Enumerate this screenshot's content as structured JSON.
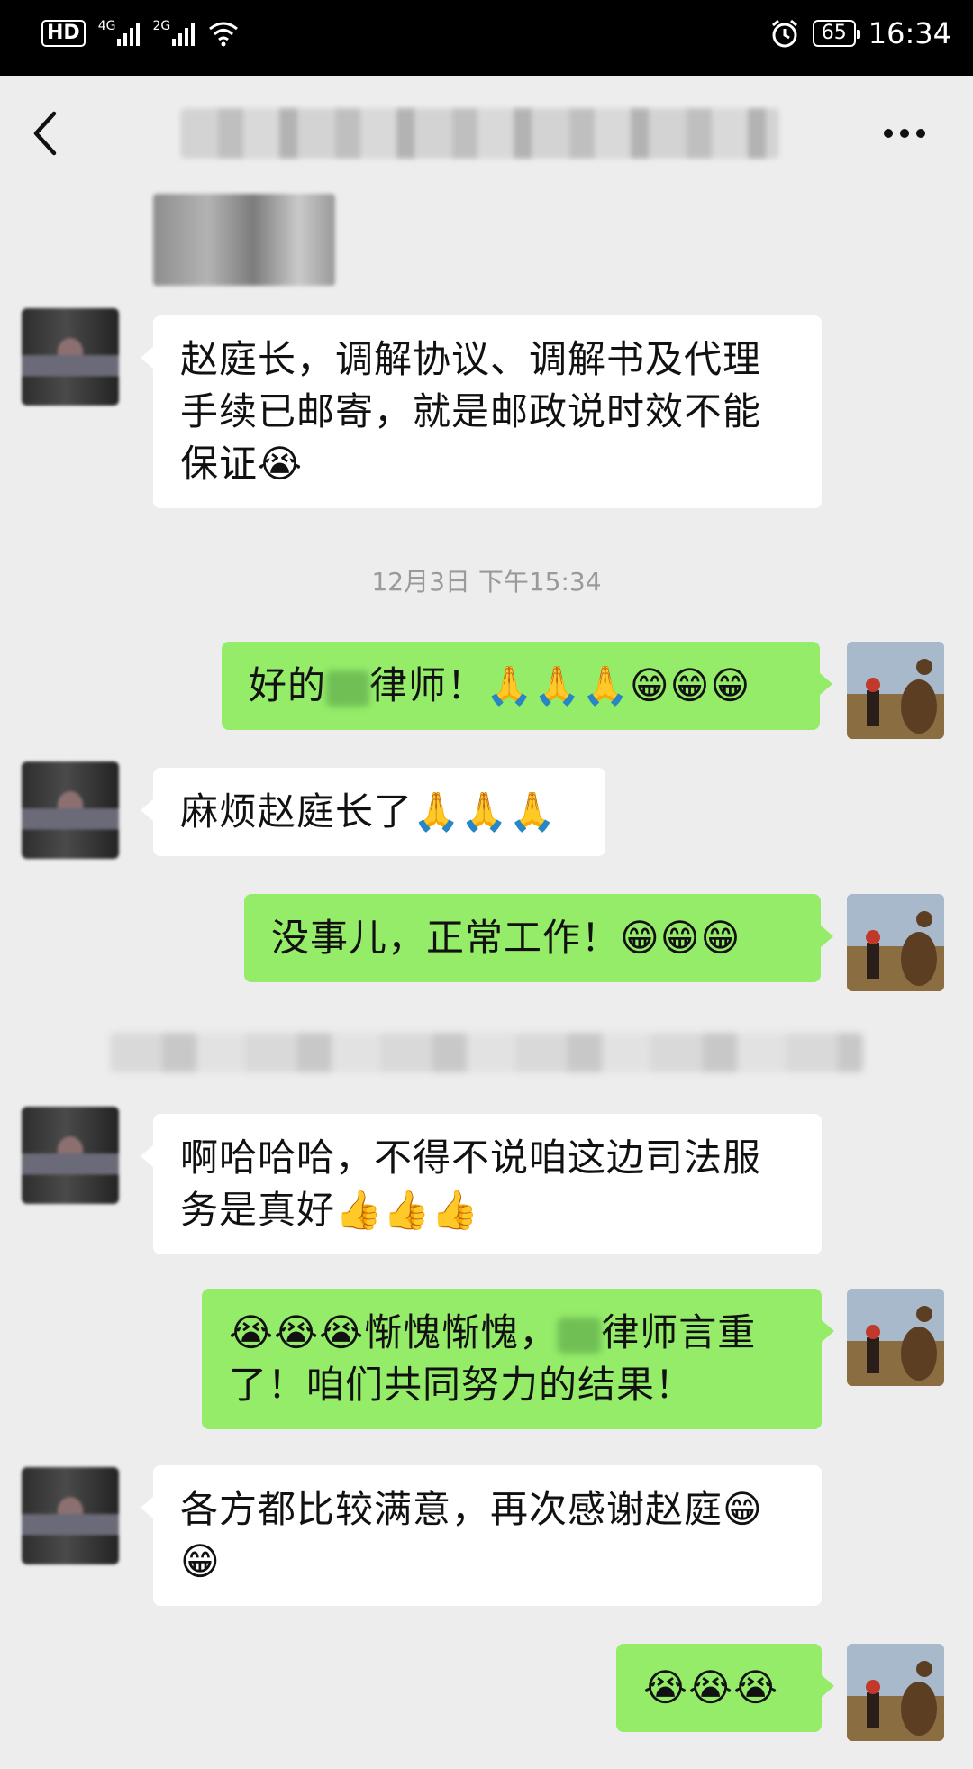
{
  "status_bar": {
    "hd": "HD",
    "net1": "4G",
    "net2": "2G",
    "battery": "65",
    "time": "16:34"
  },
  "nav": {
    "back_icon": "chevron-left-icon",
    "more_icon": "ellipsis-icon"
  },
  "timestamp": "12月3日 下午15:34",
  "messages": [
    {
      "side": "in",
      "text": "赵庭长，调解协议、调解书及代理手续已邮寄，就是邮政说时效不能保证😭"
    },
    {
      "side": "out",
      "text_before": "好的",
      "text_after": "律师！🙏🙏🙏😁😁😁"
    },
    {
      "side": "in",
      "text": "麻烦赵庭长了🙏🙏🙏"
    },
    {
      "side": "out",
      "text": "没事儿，正常工作！😁😁😁"
    },
    {
      "side": "in",
      "text": "啊哈哈哈，不得不说咱这边司法服务是真好👍👍👍"
    },
    {
      "side": "out",
      "text_before": "😭😭😭惭愧惭愧，",
      "text_after": "律师言重了！咱们共同努力的结果！"
    },
    {
      "side": "in",
      "text": "各方都比较满意，再次感谢赵庭😁😁"
    },
    {
      "side": "out",
      "text": "😭😭😭"
    }
  ],
  "colors": {
    "background": "#ededed",
    "bubble_in": "#ffffff",
    "bubble_out": "#95ec69",
    "timestamp": "#9a9a9a"
  }
}
